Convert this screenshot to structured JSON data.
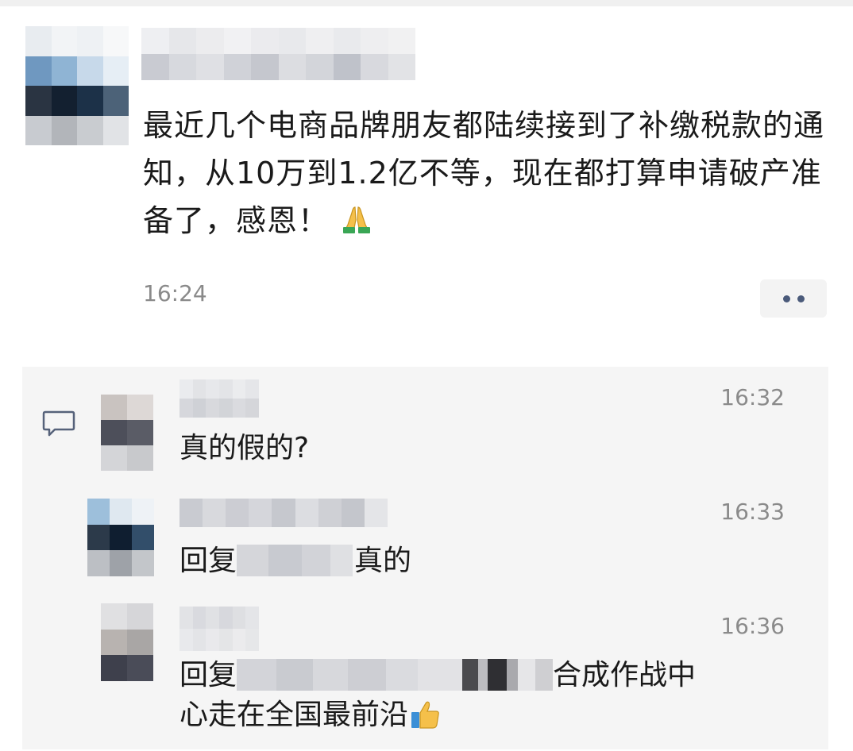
{
  "post": {
    "text": "最近几个电商品牌朋友都陆续接到了补缴税款的通知，从10万到1.2亿不等，现在都打算申请破产准备了，感恩！",
    "time": "16:24",
    "emoji": "folded-hands-icon"
  },
  "comments": [
    {
      "time": "16:32",
      "text": "真的假的?"
    },
    {
      "time": "16:33",
      "reply_prefix": "回复",
      "text": "真的"
    },
    {
      "time": "16:36",
      "reply_prefix": "回复",
      "text_line1": "合成作战中",
      "text_line2": "心走在全国最前沿",
      "emoji": "thumbs-up-icon"
    }
  ],
  "icons": {
    "comment": "comment-bubble-icon",
    "more": "more-dots-icon"
  },
  "colors": {
    "text": "#1a1a1a",
    "time": "#8a8a8a",
    "panel": "#f5f5f5",
    "dots": "#4a5a7a"
  }
}
